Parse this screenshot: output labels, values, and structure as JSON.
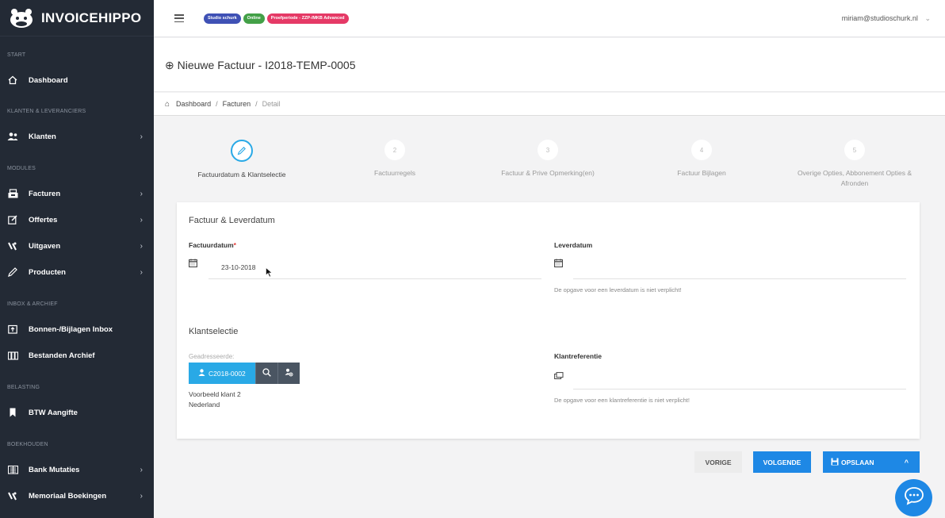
{
  "app": {
    "logo_text": "INVOICEHIPPO"
  },
  "sidebar": {
    "sections": {
      "start": "START",
      "klanten": "KLANTEN & LEVERANCIERS",
      "modules": "MODULES",
      "inbox": "INBOX & ARCHIEF",
      "belasting": "BELASTING",
      "boekhouden": "BOEKHOUDEN"
    },
    "items": {
      "dashboard": "Dashboard",
      "klanten": "Klanten",
      "facturen": "Facturen",
      "offertes": "Offertes",
      "uitgaven": "Uitgaven",
      "producten": "Producten",
      "bonnen": "Bonnen-/Bijlagen Inbox",
      "archief": "Bestanden Archief",
      "btw": "BTW Aangifte",
      "bank": "Bank Mutaties",
      "memoriaal": "Memoriaal Boekingen"
    },
    "chevron": "›"
  },
  "topbar": {
    "badges": [
      "Studio schurk",
      "Online",
      "Proefperiode - ZZP-/MKB Advanced"
    ],
    "badge_colors": [
      "#3f51b5",
      "#43a047",
      "#e53966"
    ],
    "user_email": "miriam@studioschurk.nl",
    "user_caret": "⌄"
  },
  "page": {
    "back_icon": "⊕",
    "title": "Nieuwe Factuur - I2018-TEMP-0005"
  },
  "breadcrumb": {
    "home_icon": "⌂",
    "items": [
      "Dashboard",
      "Facturen",
      "Detail"
    ],
    "separator": "/"
  },
  "steps": [
    {
      "num": "",
      "label": "Factuurdatum & Klantselectie",
      "active": true
    },
    {
      "num": "2",
      "label": "Factuurregels"
    },
    {
      "num": "3",
      "label": "Factuur & Prive Opmerking(en)"
    },
    {
      "num": "4",
      "label": "Factuur Bijlagen"
    },
    {
      "num": "5",
      "label": "Overige Opties, Abbonement Opties & Afronden"
    }
  ],
  "form": {
    "section1_title": "Factuur & Leverdatum",
    "factuurdatum_label": "Factuurdatum",
    "required_mark": "*",
    "factuurdatum_value": "23-10-2018",
    "leverdatum_label": "Leverdatum",
    "leverdatum_hint": "De opgave voor een leverdatum is niet verplicht!",
    "section2_title": "Klantselectie",
    "geadresseerde_label": "Geadresseerde:",
    "client_code": "C2018-0002",
    "client_name": "Voorbeeld klant 2",
    "client_country": "Nederland",
    "klantreferentie_label": "Klantreferentie",
    "klantreferentie_hint": "De opgave voor een klantreferentie is niet verplicht!"
  },
  "actions": {
    "vorige": "VORIGE",
    "volgende": "VOLGENDE",
    "opslaan": "OPSLAAN",
    "caret": "^"
  },
  "colors": {
    "sidebar_bg": "#232a35",
    "accent": "#29a9e6",
    "primary": "#1e88e5"
  }
}
